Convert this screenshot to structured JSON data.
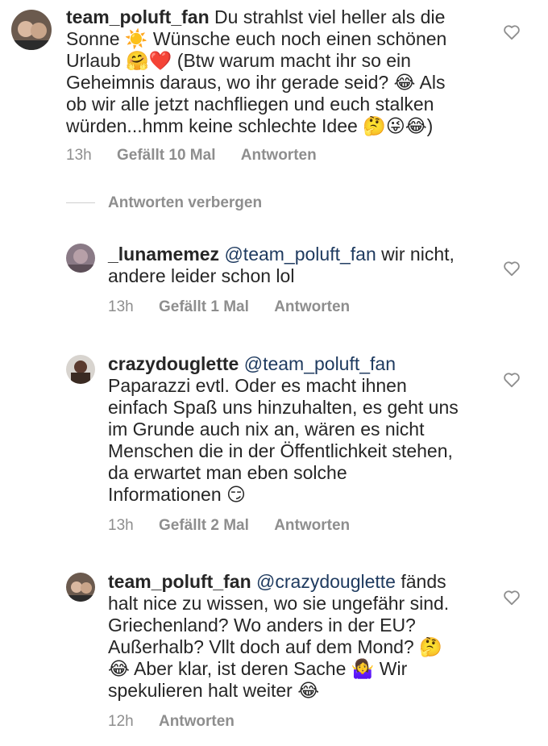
{
  "comments": [
    {
      "username": "team_poluft_fan",
      "mention": "",
      "text_lines": [
        "Du strahlst viel heller als die",
        "Sonne ☀️ Wünsche euch noch einen schönen",
        "Urlaub 🤗❤️ (Btw warum macht ihr so ein",
        "Geheimnis daraus, wo ihr gerade seid? 😂 Als",
        "ob wir alle jetzt nachfliegen und euch stalken",
        "würden...hmm keine schlechte Idee 🤔😜😂)"
      ],
      "time": "13h",
      "likes": "Gefällt 10 Mal",
      "reply": "Antworten"
    },
    {
      "username": "_lunamemez",
      "mention": "@team_poluft_fan",
      "text_lines": [
        "wir nicht,",
        "andere leider schon lol"
      ],
      "time": "13h",
      "likes": "Gefällt 1 Mal",
      "reply": "Antworten"
    },
    {
      "username": "crazydouglette",
      "mention": "@team_poluft_fan",
      "text_lines": [
        "Paparazzi evtl. Oder es macht ihnen",
        "einfach Spaß uns hinzuhalten, es geht uns",
        "im Grunde auch nix an, wären es nicht",
        "Menschen die in der Öffentlichkeit stehen,",
        "da erwartet man eben solche",
        "Informationen 😏"
      ],
      "time": "13h",
      "likes": "Gefällt 2 Mal",
      "reply": "Antworten"
    },
    {
      "username": "team_poluft_fan",
      "mention": "@crazydouglette",
      "text_lines": [
        "fänds",
        "halt nice zu wissen, wo sie ungefähr sind.",
        "Griechenland? Wo anders in der EU?",
        "Außerhalb? Vllt doch auf dem Mond? 🤔",
        "😂 Aber klar, ist deren Sache 🤷‍♀️ Wir",
        "spekulieren halt weiter 😂"
      ],
      "time": "12h",
      "likes": "",
      "reply": "Antworten"
    }
  ],
  "hide_replies_label": "Antworten verbergen",
  "icons": {
    "like": "heart-outline-icon"
  },
  "colors": {
    "meta": "#8e8e8e",
    "text": "#262626",
    "mention": "#1e3a5f"
  }
}
